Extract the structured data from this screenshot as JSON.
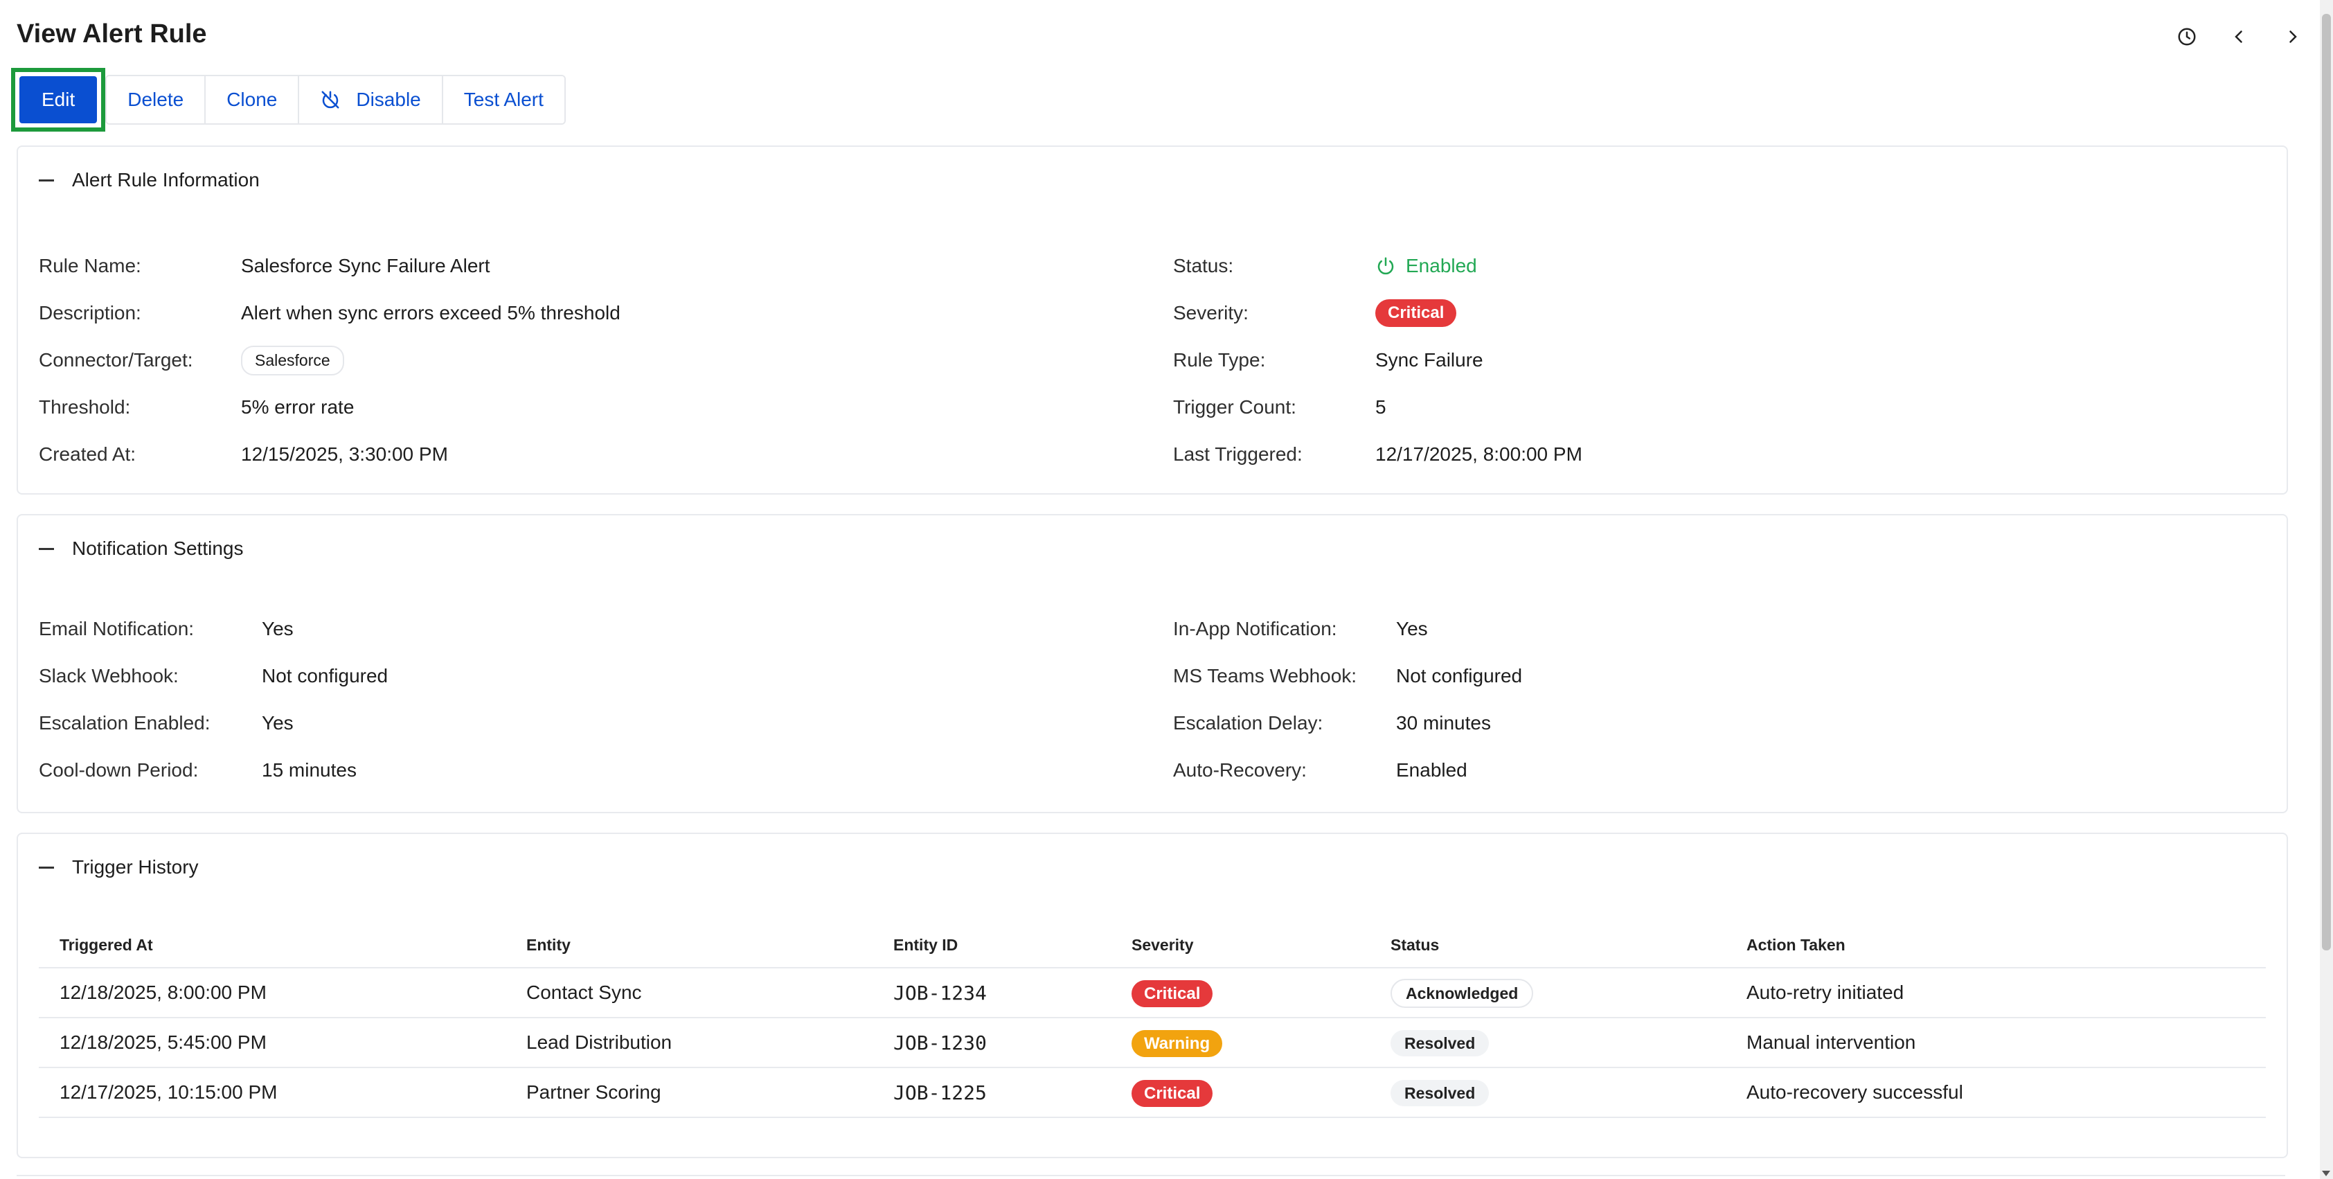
{
  "header": {
    "title": "View Alert Rule",
    "icons": [
      "history-icon",
      "chevron-left-icon",
      "chevron-right-icon"
    ]
  },
  "toolbar": {
    "edit_label": "Edit",
    "delete_label": "Delete",
    "clone_label": "Clone",
    "disable_label": "Disable",
    "test_label": "Test Alert"
  },
  "alert_info": {
    "title": "Alert Rule Information",
    "rule_name_label": "Rule Name:",
    "rule_name": "Salesforce Sync Failure Alert",
    "description_label": "Description:",
    "description": "Alert when sync errors exceed 5% threshold",
    "connector_label": "Connector/Target:",
    "connector": "Salesforce",
    "threshold_label": "Threshold:",
    "threshold": "5% error rate",
    "created_label": "Created At:",
    "created": "12/15/2025, 3:30:00 PM",
    "status_label": "Status:",
    "status": "Enabled",
    "severity_label": "Severity:",
    "severity": "Critical",
    "rule_type_label": "Rule Type:",
    "rule_type": "Sync Failure",
    "trigger_count_label": "Trigger Count:",
    "trigger_count": "5",
    "last_triggered_label": "Last Triggered:",
    "last_triggered": "12/17/2025, 8:00:00 PM"
  },
  "notifications": {
    "title": "Notification Settings",
    "email_label": "Email Notification:",
    "email": "Yes",
    "slack_label": "Slack Webhook:",
    "slack": "Not configured",
    "escalation_label": "Escalation Enabled:",
    "escalation": "Yes",
    "cooldown_label": "Cool-down Period:",
    "cooldown": "15 minutes",
    "inapp_label": "In-App Notification:",
    "inapp": "Yes",
    "teams_label": "MS Teams Webhook:",
    "teams": "Not configured",
    "delay_label": "Escalation Delay:",
    "delay": "30 minutes",
    "autorecovery_label": "Auto-Recovery:",
    "autorecovery": "Enabled"
  },
  "history": {
    "title": "Trigger History",
    "columns": [
      "Triggered At",
      "Entity",
      "Entity ID",
      "Severity",
      "Status",
      "Action Taken"
    ],
    "rows": [
      [
        "12/18/2025, 8:00:00 PM",
        "Contact Sync",
        "JOB-1234",
        "Critical",
        "Acknowledged",
        "Auto-retry initiated"
      ],
      [
        "12/18/2025, 5:45:00 PM",
        "Lead Distribution",
        "JOB-1230",
        "Warning",
        "Resolved",
        "Manual intervention"
      ],
      [
        "12/17/2025, 10:15:00 PM",
        "Partner Scoring",
        "JOB-1225",
        "Critical",
        "Resolved",
        "Auto-recovery successful"
      ]
    ]
  },
  "colors": {
    "primary": "#0a4fd1",
    "focus_outline": "#1d9a3c",
    "critical": "#e5393b",
    "warning": "#f2a30f",
    "enabled": "#22a854"
  }
}
